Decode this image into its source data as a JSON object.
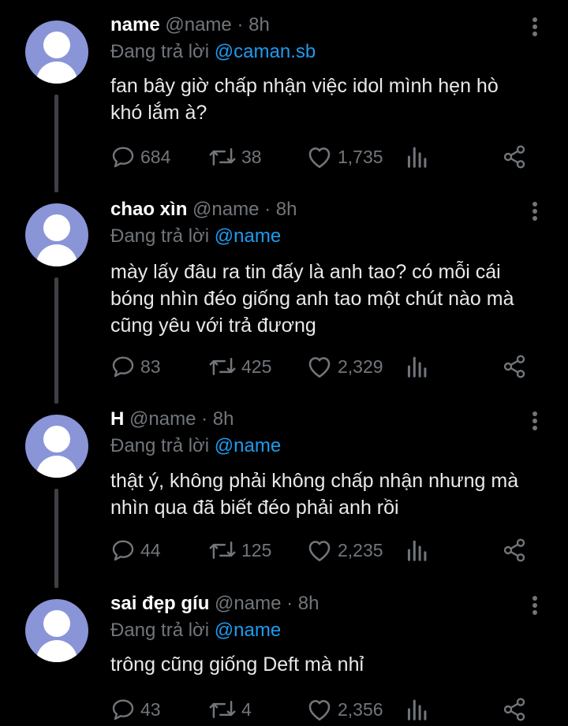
{
  "tweets": [
    {
      "name": "name",
      "handle": "@name",
      "time": "· 8h",
      "reply_prefix": "Đang trả lời",
      "reply_to": "@caman.sb",
      "text_lines": [
        "fan bây giờ chấp nhận việc idol mình hẹn hò",
        "khó lắm à?"
      ],
      "replies": "684",
      "retweets": "38",
      "likes": "1,735"
    },
    {
      "name": "chao xìn",
      "handle": "@name",
      "time": "· 8h",
      "reply_prefix": "Đang trả lời",
      "reply_to": "@name",
      "text_lines": [
        "mày lấy đâu ra tin đấy là anh tao? có mỗi cái",
        "bóng nhìn đéo giống anh tao một chút nào mà",
        "cũng yêu với trả đương"
      ],
      "replies": "83",
      "retweets": "425",
      "likes": "2,329"
    },
    {
      "name": "H",
      "handle": "@name",
      "time": "· 8h",
      "reply_prefix": "Đang trả lời",
      "reply_to": "@name",
      "text_lines": [
        "thật ý, không phải không chấp nhận nhưng mà",
        "nhìn qua đã biết đéo phải anh rồi"
      ],
      "replies": "44",
      "retweets": "125",
      "likes": "2,235"
    },
    {
      "name": "sai đẹp gíu",
      "handle": "@name",
      "time": "· 8h",
      "reply_prefix": "Đang trả lời",
      "reply_to": "@name",
      "text_lines": [
        "trông cũng giống Deft mà nhỉ"
      ],
      "replies": "43",
      "retweets": "4",
      "likes": "2,356"
    }
  ],
  "icons": {
    "reply": "reply-icon",
    "retweet": "retweet-icon",
    "like": "heart-icon",
    "stats": "stats-icon",
    "share": "share-icon",
    "more": "more-icon"
  },
  "colors": {
    "background": "#000000",
    "text": "#e7e9ea",
    "muted": "#71767b",
    "mention": "#1d9bf0",
    "avatar": "#8a95d8"
  }
}
